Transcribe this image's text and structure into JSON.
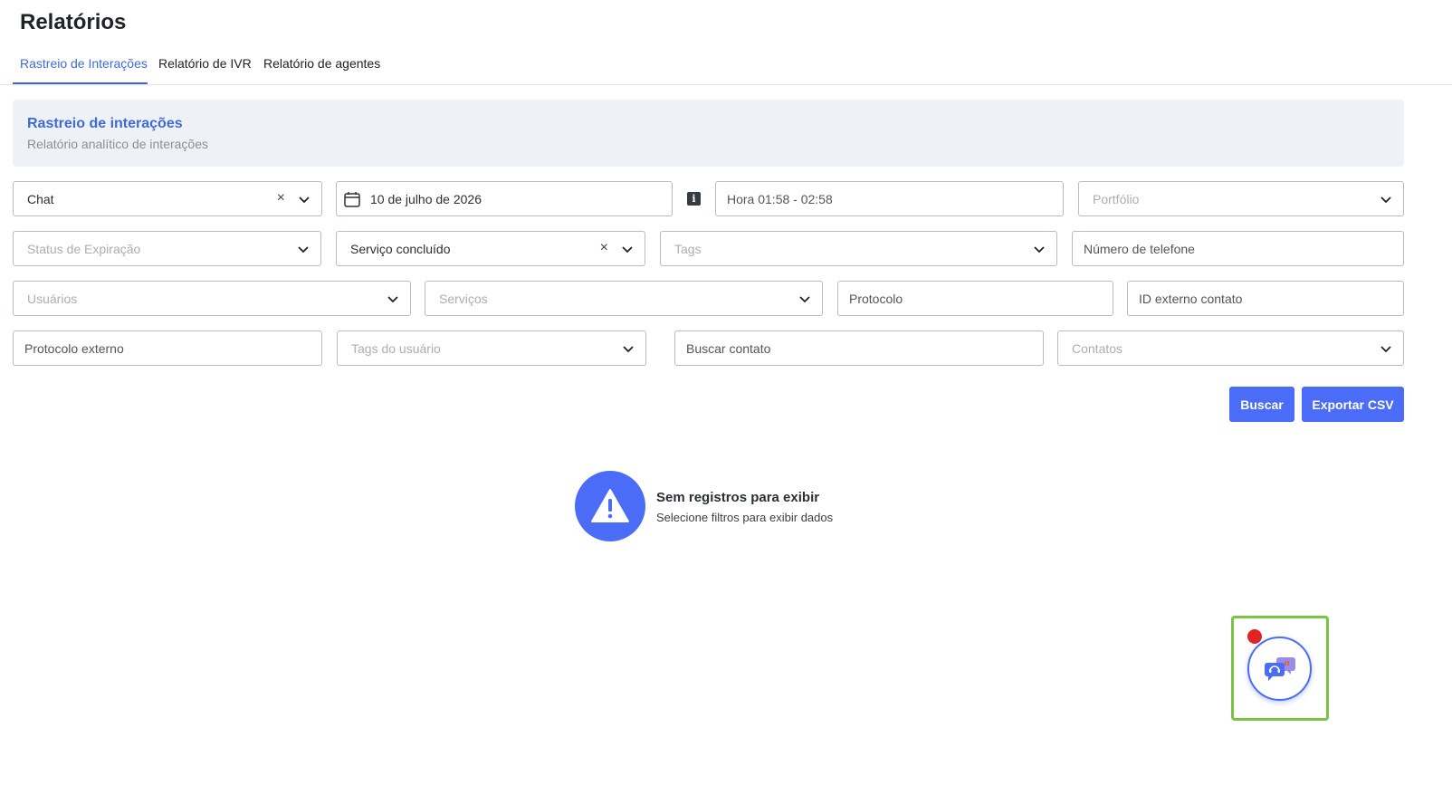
{
  "page": {
    "title": "Relatórios"
  },
  "tabs": [
    {
      "label": "Rastreio de Interações",
      "active": true
    },
    {
      "label": "Relatório de IVR",
      "active": false
    },
    {
      "label": "Relatório de agentes",
      "active": false
    }
  ],
  "header_card": {
    "title": "Rastreio de interações",
    "subtitle": "Relatório analítico de interações"
  },
  "filters": {
    "channel": {
      "value": "Chat"
    },
    "date": {
      "value": "10 de julho de 2026"
    },
    "hour": {
      "value": "Hora 01:58 - 02:58"
    },
    "portfolio": {
      "placeholder": "Portfólio"
    },
    "expiration_status": {
      "placeholder": "Status de Expiração"
    },
    "service_status": {
      "value": "Serviço concluído"
    },
    "tags": {
      "placeholder": "Tags"
    },
    "phone": {
      "value": "Número de telefone"
    },
    "users": {
      "placeholder": "Usuários"
    },
    "services": {
      "placeholder": "Serviços"
    },
    "protocol": {
      "value": "Protocolo"
    },
    "external_contact_id": {
      "value": "ID externo contato"
    },
    "external_protocol": {
      "value": "Protocolo externo"
    },
    "user_tags": {
      "placeholder": "Tags do usuário"
    },
    "search_contact": {
      "value": "Buscar contato"
    },
    "contacts": {
      "placeholder": "Contatos"
    }
  },
  "actions": {
    "search_label": "Buscar",
    "export_label": "Exportar CSV"
  },
  "empty_state": {
    "title": "Sem registros para exibir",
    "subtitle": "Selecione filtros para exibir dados",
    "icon": "warning-triangle-icon"
  },
  "colors": {
    "accent": "#4a6cf7",
    "tab_active": "#3f6ad8",
    "card_bg": "#eef2f7",
    "notification": "#e02424",
    "highlight": "#7cc244"
  }
}
